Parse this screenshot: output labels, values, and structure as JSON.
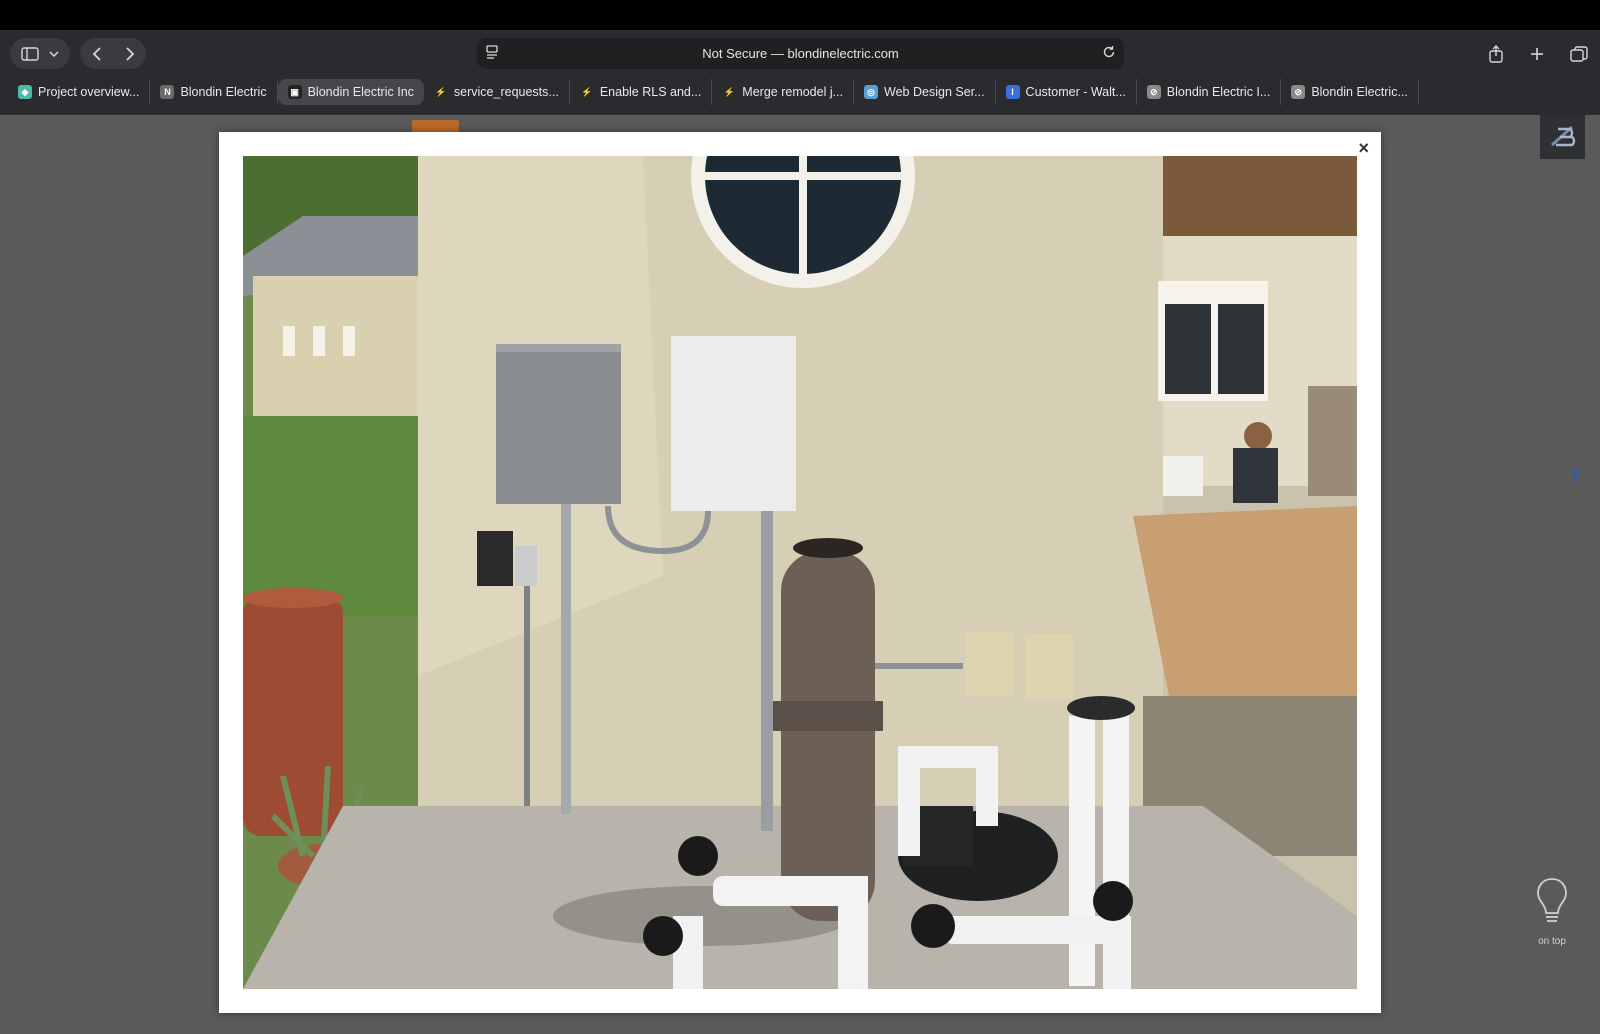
{
  "browser": {
    "url_text": "Not Secure — blondinelectric.com",
    "tabs": [
      {
        "label": "Project overview...",
        "icon": "diamond-icon",
        "color": "#4fb8a8"
      },
      {
        "label": "Blondin Electric",
        "icon": "notion-icon",
        "color": "#6b6b6b"
      },
      {
        "label": "Blondin Electric Inc",
        "icon": "site-logo-icon",
        "color": "#222222",
        "active": true
      },
      {
        "label": "service_requests...",
        "icon": "supabase-icon",
        "color": "#2a2a2a"
      },
      {
        "label": "Enable RLS and...",
        "icon": "supabase-icon",
        "color": "#2a2a2a"
      },
      {
        "label": "Merge remodel j...",
        "icon": "supabase-icon",
        "color": "#2a2a2a"
      },
      {
        "label": "Web Design Ser...",
        "icon": "webflow-icon",
        "color": "#5a9fd4"
      },
      {
        "label": "Customer - Walt...",
        "icon": "intercom-icon",
        "color": "#3b6fe0"
      },
      {
        "label": "Blondin Electric I...",
        "icon": "compass-icon",
        "color": "#8a8a8a"
      },
      {
        "label": "Blondin Electric...",
        "icon": "compass-icon",
        "color": "#8a8a8a"
      }
    ]
  },
  "page": {
    "lightbox_close": "×",
    "photo_alt": "Pool equipment pad with electrical panels on stucco wall",
    "facebook_glyph": "f",
    "on_top_label": "on top"
  }
}
